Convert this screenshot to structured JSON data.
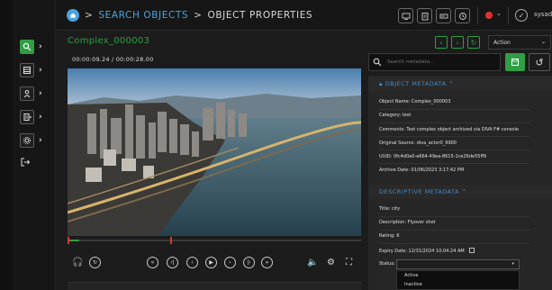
{
  "breadcrumb": {
    "section": "SEARCH OBJECTS",
    "page": "OBJECT PROPERTIES",
    "separator": ">"
  },
  "user": {
    "name": "sysadr"
  },
  "object": {
    "title": "Complex_000003",
    "action_label": "Action"
  },
  "player": {
    "current_time": "00:00:09.24",
    "time_separator": "/",
    "duration": "00:00:28.00",
    "progress_fraction": 0.04
  },
  "search": {
    "placeholder": "Search metadata..."
  },
  "object_metadata": {
    "heading": "OBJECT METADATA",
    "fields": [
      {
        "label": "Object Name:",
        "value": "Complex_000003"
      },
      {
        "label": "Category:",
        "value": "test"
      },
      {
        "label": "Comments:",
        "value": "Test complex object archived via DIVA F# console"
      },
      {
        "label": "Original Source:",
        "value": "diva_actor0_9900"
      },
      {
        "label": "UUID:",
        "value": "0fc4d0a0-e664-49ea-8615-1ce26de55ff9"
      },
      {
        "label": "Archive Date:",
        "value": "01/06/2023 3:17:42 PM"
      }
    ]
  },
  "descriptive_metadata": {
    "heading": "DESCRIPTIVE METADATA",
    "fields": [
      {
        "label": "Title:",
        "value": "city"
      },
      {
        "label": "Description:",
        "value": "Flyover shot"
      },
      {
        "label": "Rating:",
        "value": "6"
      },
      {
        "label": "Expiry Date:",
        "value": "12/31/2024 10:04:24 AM"
      }
    ],
    "status_label": "Status:",
    "status_options": [
      "Active",
      "Inactive"
    ]
  },
  "icons": {
    "home": "home-icon",
    "chevron_up": "⌃",
    "chevron_down": "⌄",
    "caret": "▾"
  },
  "colors": {
    "accent_green": "#2f9e44",
    "link_blue": "#4aa3df",
    "record_red": "#e03131"
  }
}
